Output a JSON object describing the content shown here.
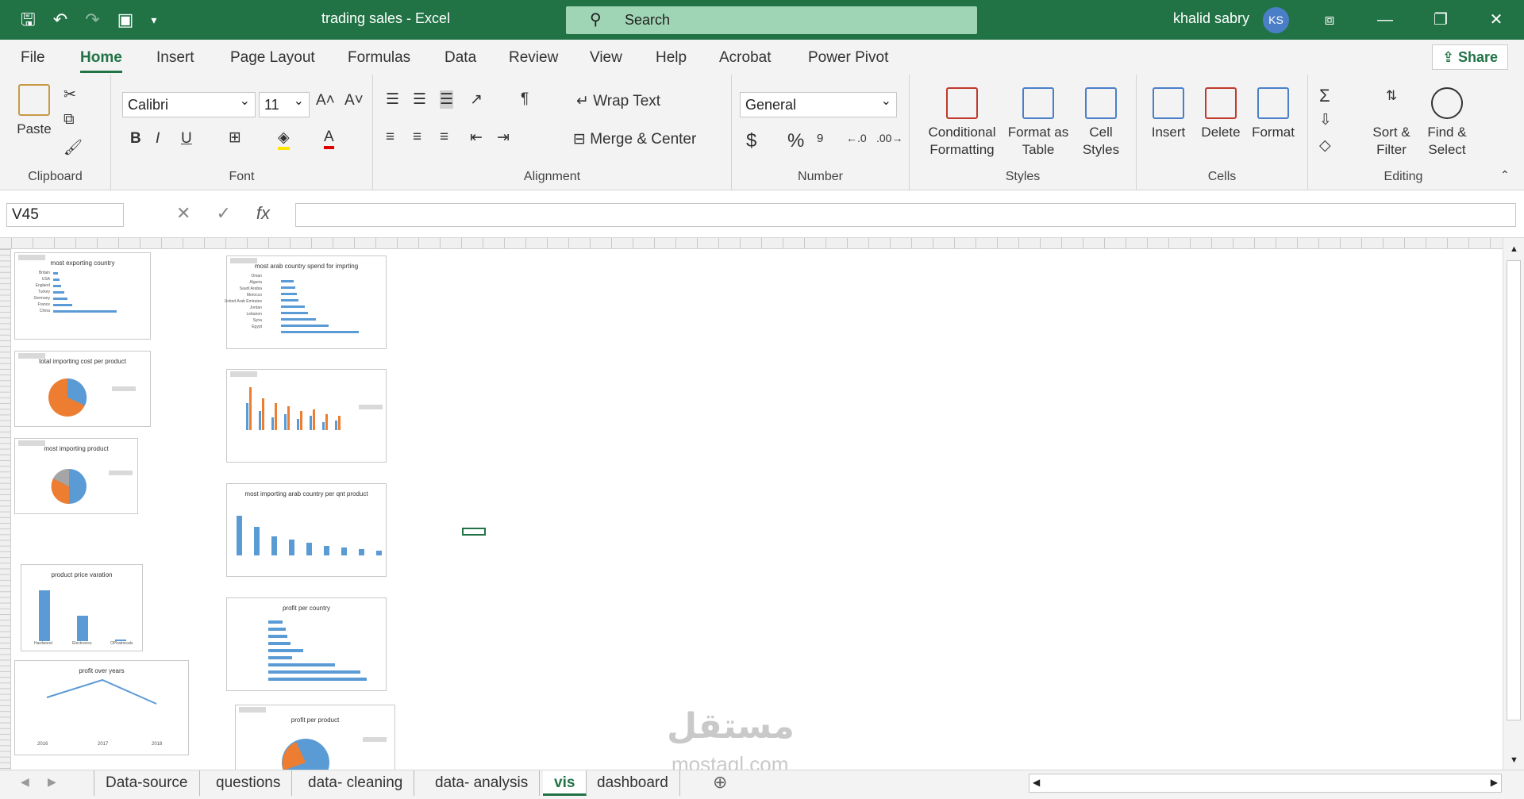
{
  "title_bar": {
    "doc_title": "trading sales  -  Excel",
    "search_placeholder": "Search",
    "user_name": "khalid sabry",
    "user_initials": "KS"
  },
  "menu": {
    "tabs": [
      "File",
      "Home",
      "Insert",
      "Page Layout",
      "Formulas",
      "Data",
      "Review",
      "View",
      "Help",
      "Acrobat",
      "Power Pivot"
    ],
    "active": "Home",
    "share": "Share"
  },
  "ribbon": {
    "clipboard": {
      "paste": "Paste",
      "label": "Clipboard"
    },
    "font": {
      "name": "Calibri",
      "size": "11",
      "label": "Font",
      "bold": "B",
      "italic": "I",
      "underline": "U"
    },
    "alignment": {
      "wrap": "Wrap Text",
      "merge": "Merge & Center",
      "label": "Alignment"
    },
    "number": {
      "format": "General",
      "label": "Number",
      "currency": "$",
      "percent": "%"
    },
    "styles": {
      "cond1": "Conditional",
      "cond2": "Formatting",
      "fmt1": "Format as",
      "fmt2": "Table",
      "cell1": "Cell",
      "cell2": "Styles",
      "label": "Styles"
    },
    "cells": {
      "insert": "Insert",
      "delete": "Delete",
      "format": "Format",
      "label": "Cells"
    },
    "editing": {
      "sort1": "Sort &",
      "sort2": "Filter",
      "find1": "Find &",
      "find2": "Select",
      "label": "Editing"
    }
  },
  "formula_bar": {
    "name_box": "V45",
    "fx": "fx"
  },
  "charts": {
    "c1": {
      "title": "most exporting country",
      "categories": [
        "Britain",
        "USA",
        "England",
        "Turkey",
        "Germany",
        "France",
        "China"
      ]
    },
    "c2": {
      "title": "most arab country spend for imprting",
      "categories": [
        "Oman",
        "Algeria",
        "Saudi Arabia",
        "Morocco",
        "United Arab Emirates",
        "Jordan",
        "Lebanon",
        "Syria",
        "Egypt"
      ]
    },
    "c3": {
      "title": "total importing cost per product"
    },
    "c4": {
      "title": ""
    },
    "c5": {
      "title": "most importing product"
    },
    "c6": {
      "title": "most importing arab country per qnt product"
    },
    "c7": {
      "title": "product price varation",
      "categories": [
        "Hardwood",
        "Electronics",
        "OPhatmicals"
      ]
    },
    "c8": {
      "title": "profit per country"
    },
    "c9": {
      "title": "profit over years",
      "years": [
        "2016",
        "2017",
        "2018"
      ]
    },
    "c10": {
      "title": "profit per product"
    }
  },
  "sheets": [
    "Data-source",
    "questions",
    "data- cleaning",
    "data- analysis",
    "vis",
    "dashboard"
  ],
  "active_sheet": "vis",
  "watermark": {
    "arabic": "مستقل",
    "latin": "mostaql.com"
  }
}
